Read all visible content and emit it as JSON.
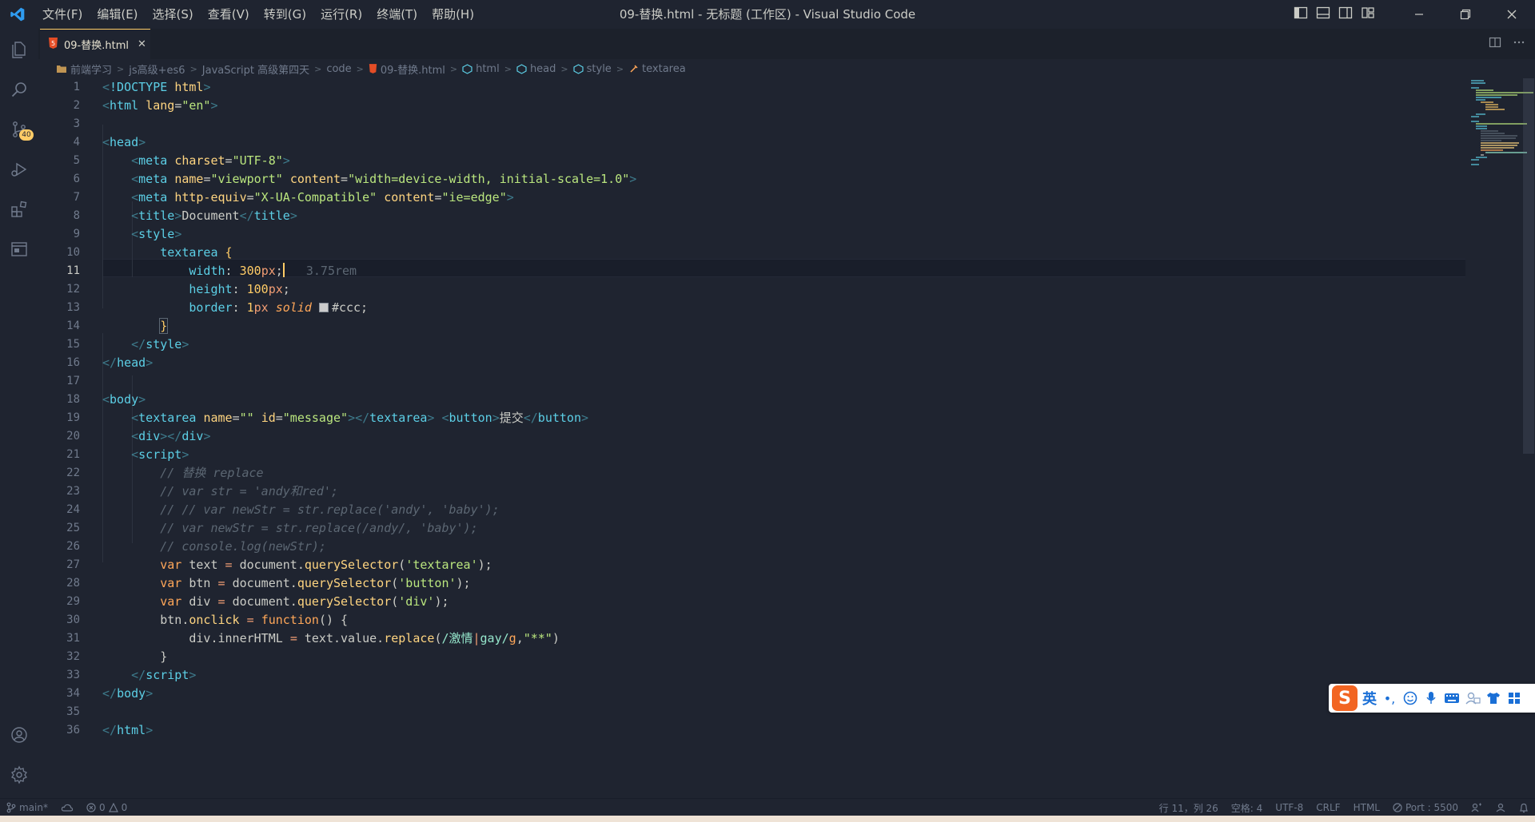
{
  "window": {
    "title": "09-替换.html - 无标题 (工作区) - Visual Studio Code"
  },
  "menu": [
    "文件(F)",
    "编辑(E)",
    "选择(S)",
    "查看(V)",
    "转到(G)",
    "运行(R)",
    "终端(T)",
    "帮助(H)"
  ],
  "activity": {
    "scm_badge": "40"
  },
  "tab": {
    "label": "09-替换.html",
    "close": "✕"
  },
  "breadcrumb": [
    "前端学习",
    "js高级+es6",
    "JavaScript 高级第四天",
    "code",
    "09-替换.html",
    "html",
    "head",
    "style",
    "textarea"
  ],
  "editor": {
    "active_line": 11,
    "inlay_hint": "3.75rem",
    "line_numbers": [
      "1",
      "2",
      "3",
      "4",
      "5",
      "6",
      "7",
      "8",
      "9",
      "10",
      "11",
      "12",
      "13",
      "14",
      "15",
      "16",
      "17",
      "18",
      "19",
      "20",
      "21",
      "22",
      "23",
      "24",
      "25",
      "26",
      "27",
      "28",
      "29",
      "30",
      "31",
      "32",
      "33",
      "34",
      "35",
      "36"
    ]
  },
  "colors": {
    "background": "#1f2430",
    "accent": "#ffcc66",
    "tag": "#5ccfe6",
    "string": "#bae67e",
    "keyword": "#ffa759",
    "comment": "#5c6773"
  },
  "statusbar": {
    "branch": "main*",
    "errors": "0",
    "warnings": "0",
    "position": "行 11，列 26",
    "spaces": "空格: 4",
    "encoding": "UTF-8",
    "eol": "CRLF",
    "language": "HTML",
    "port": "Port : 5500"
  },
  "ime": {
    "lang": "英",
    "punct": "•,"
  }
}
